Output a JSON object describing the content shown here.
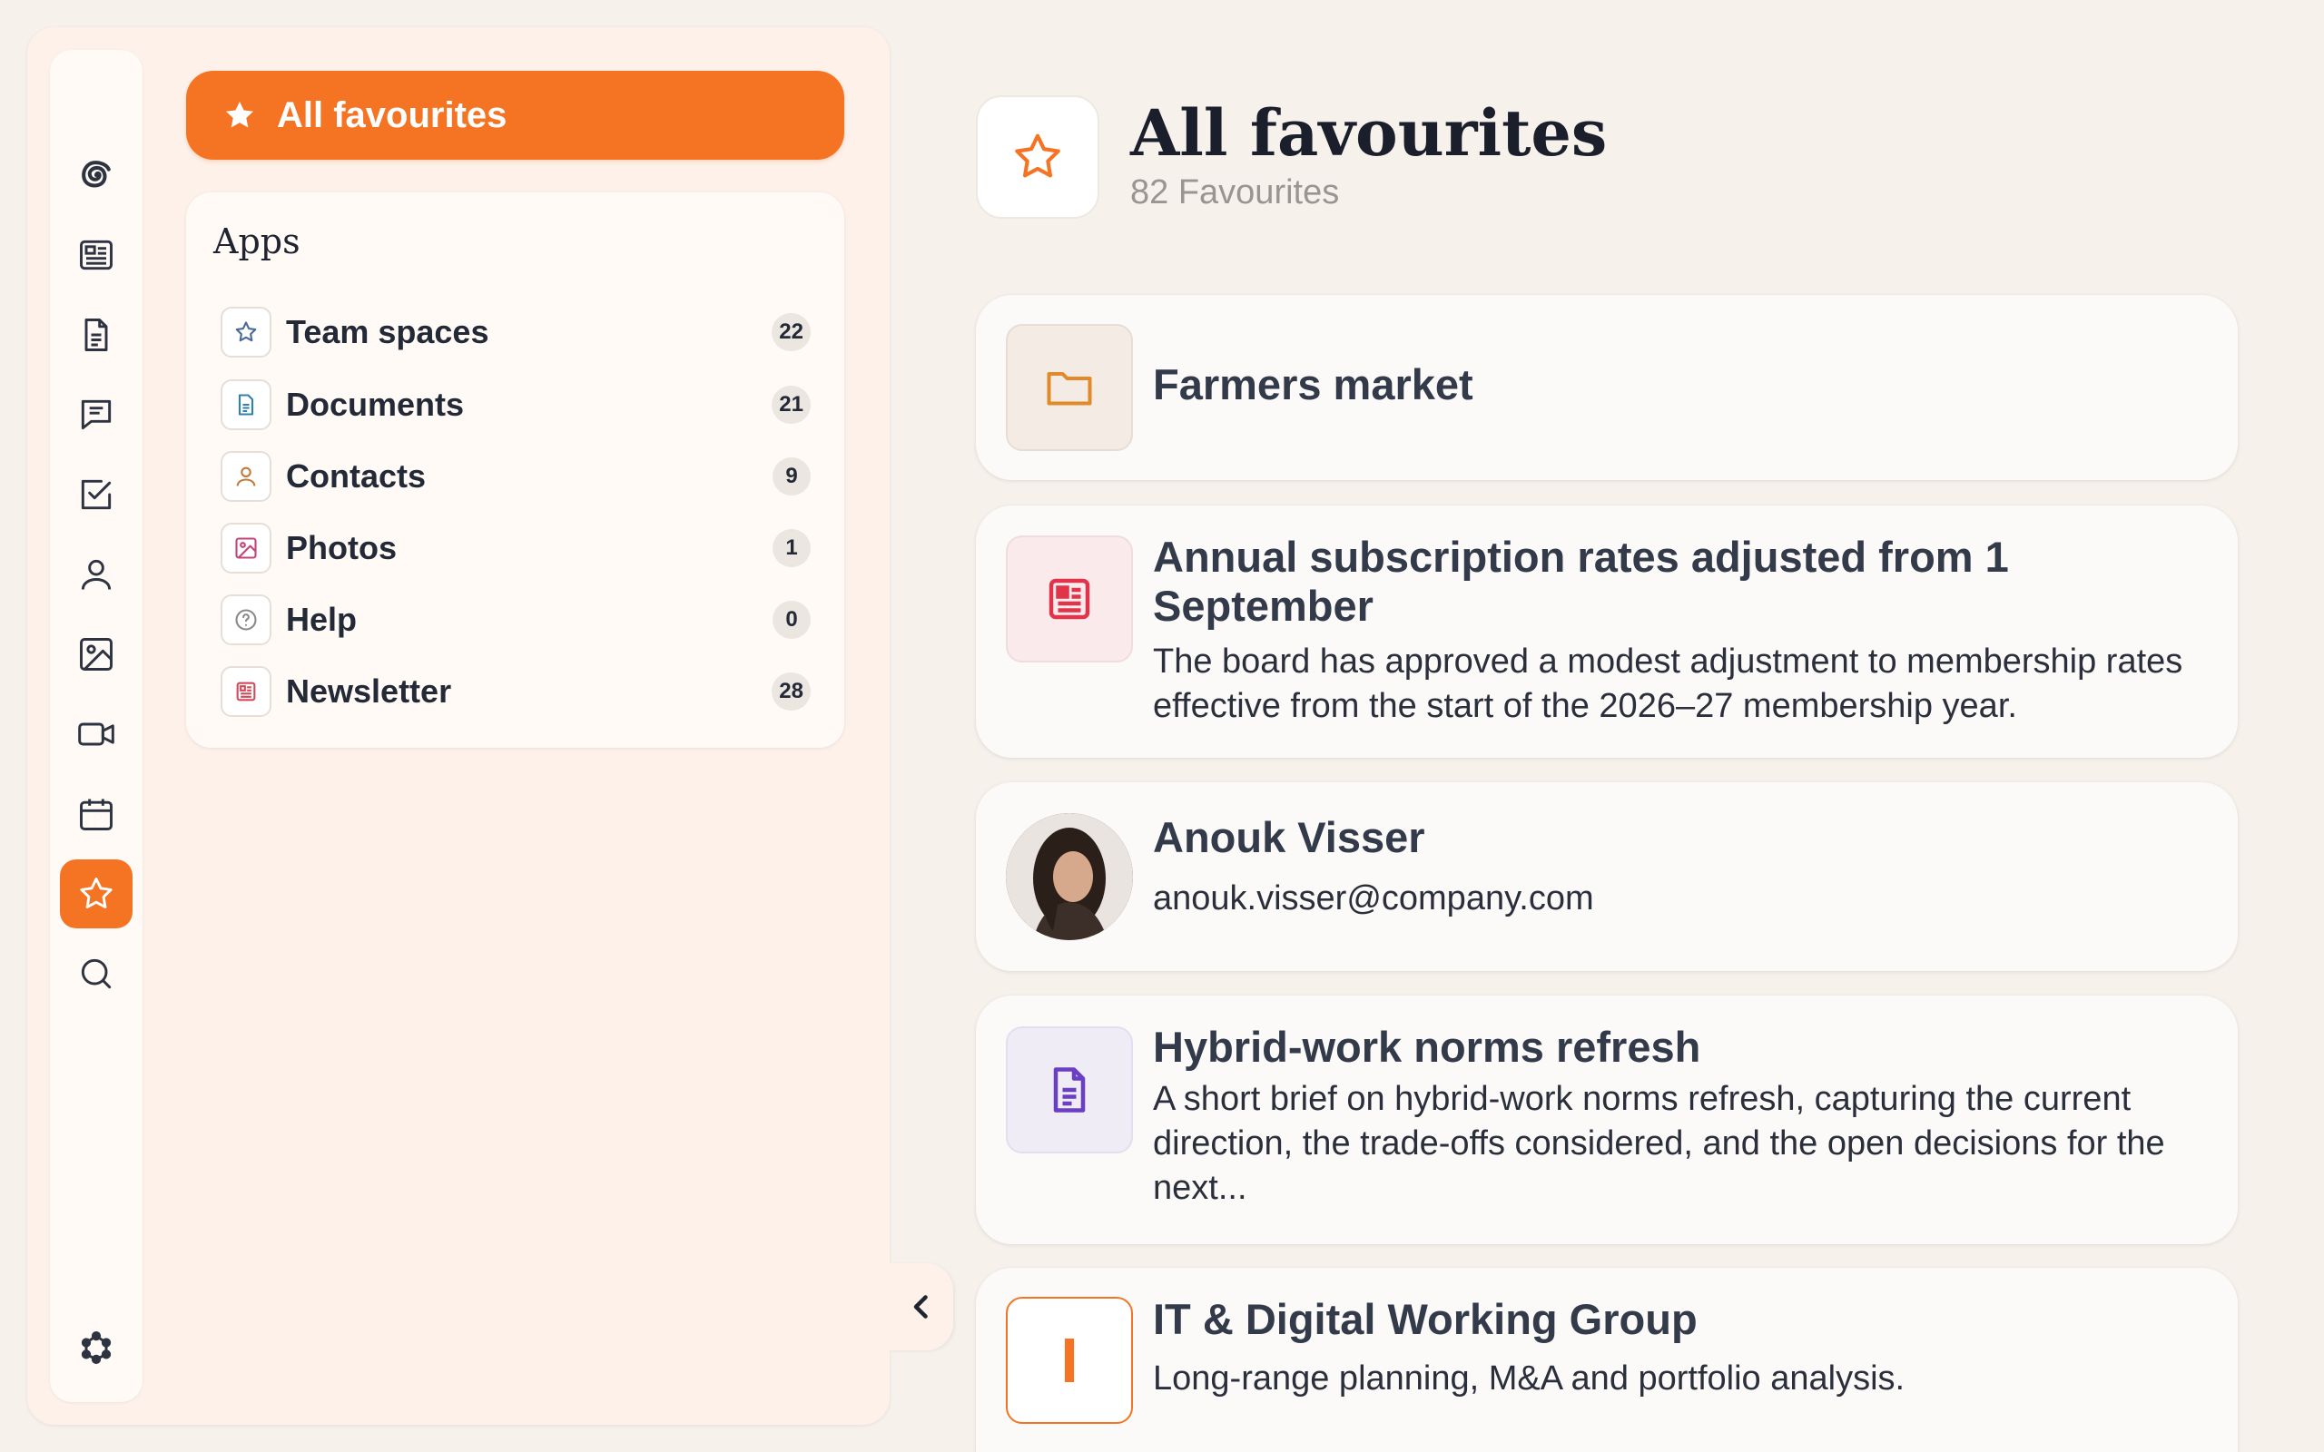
{
  "sidebar": {
    "fav_label": "All favourites",
    "apps_title": "Apps",
    "apps": [
      {
        "label": "Team spaces",
        "count": "22",
        "icon": "team-spaces-icon",
        "color": "#4a6a9a"
      },
      {
        "label": "Documents",
        "count": "21",
        "icon": "document-icon",
        "color": "#2f7fb0"
      },
      {
        "label": "Contacts",
        "count": "9",
        "icon": "person-icon",
        "color": "#c07a3a"
      },
      {
        "label": "Photos",
        "count": "1",
        "icon": "image-icon",
        "color": "#c0467a"
      },
      {
        "label": "Help",
        "count": "0",
        "icon": "help-icon",
        "color": "#8a8a8a"
      },
      {
        "label": "Newsletter",
        "count": "28",
        "icon": "newsletter-icon",
        "color": "#d04a5a"
      }
    ]
  },
  "rail": {
    "items": [
      "logo-swirl-icon",
      "news-icon",
      "document-icon",
      "chat-icon",
      "tasks-icon",
      "person-icon",
      "image-icon",
      "video-icon",
      "calendar-icon",
      "star-icon",
      "search-icon"
    ],
    "active": "star-icon",
    "bottom": "network-icon"
  },
  "main": {
    "title": "All favourites",
    "subtitle": "82 Favourites",
    "cards": [
      {
        "type": "folder",
        "title": "Farmers market"
      },
      {
        "type": "newsletter",
        "title": "Annual subscription rates adjusted from 1 September",
        "desc": "The board has approved a modest adjustment to membership rates effective from the start of the 2026–27 membership year."
      },
      {
        "type": "contact",
        "title": "Anouk Visser",
        "desc": "anouk.visser@company.com"
      },
      {
        "type": "document",
        "title": "Hybrid-work norms refresh",
        "desc": "A short brief on hybrid-work norms refresh, capturing the current direction, the trade-offs considered, and the open decisions for the next..."
      },
      {
        "type": "team",
        "title": "IT & Digital Working Group",
        "desc": "Long-range planning, M&A and portfolio analysis.",
        "initial": "I"
      }
    ]
  },
  "colors": {
    "accent": "#f47424",
    "background": "#f7f1ec"
  }
}
